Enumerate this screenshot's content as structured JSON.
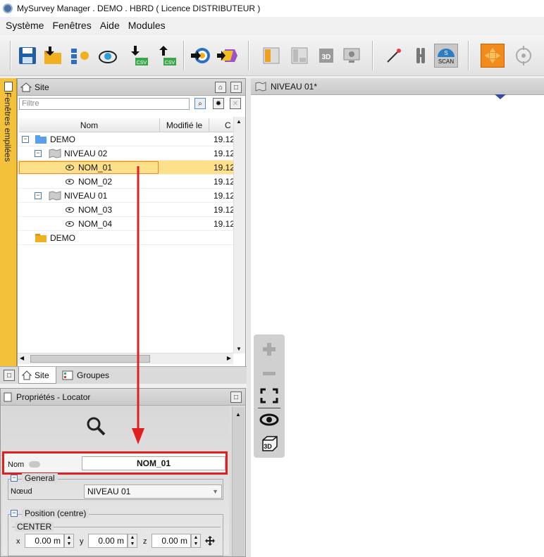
{
  "window": {
    "title": "MySurvey Manager  .  DEMO  .  HBRD ( Licence DISTRIBUTEUR )"
  },
  "menu": [
    "Système",
    "Fenêtres",
    "Aide",
    "Modules"
  ],
  "toolbar": {
    "csv_label_1": "CSV",
    "csv_label_2": "CSV",
    "threed_label": "3D",
    "scan_s": "S",
    "scan_label": "SCAN"
  },
  "sidebar": {
    "label": "Fenêtres empilées"
  },
  "site_panel": {
    "title": "Site",
    "filter_placeholder": "Filtre",
    "columns": [
      "Nom",
      "Modifié le",
      "C"
    ],
    "rows": [
      {
        "label": "DEMO",
        "date": "19.12"
      },
      {
        "label": "NIVEAU 02",
        "date": "19.12"
      },
      {
        "label": "NOM_01",
        "date": "19.12"
      },
      {
        "label": "NOM_02",
        "date": "19.12"
      },
      {
        "label": "NIVEAU 01",
        "date": "19.12"
      },
      {
        "label": "NOM_03",
        "date": "19.12"
      },
      {
        "label": "NOM_04",
        "date": "19.12"
      },
      {
        "label": "DEMO",
        "date": ""
      }
    ],
    "tabs": [
      "Site",
      "Groupes"
    ]
  },
  "properties_panel": {
    "title": "Propriétés - Locator",
    "nom_label": "Nom",
    "nom_value": "NOM_01",
    "general_label": "General",
    "noeud_label": "Nœud",
    "noeud_value": "NIVEAU 01",
    "position_label": "Position (centre)",
    "center_label": "CENTER",
    "x_label": "x",
    "x_value": "0.00 m",
    "y_label": "y",
    "y_value": "0.00 m",
    "z_label": "z",
    "z_value": "0.00 m"
  },
  "view": {
    "title": "NIVEAU 01*",
    "threed_button": "3D"
  },
  "colors": {
    "accent": "#f3c23a",
    "selection": "#ffe08a",
    "highlight_red": "#e02020"
  }
}
